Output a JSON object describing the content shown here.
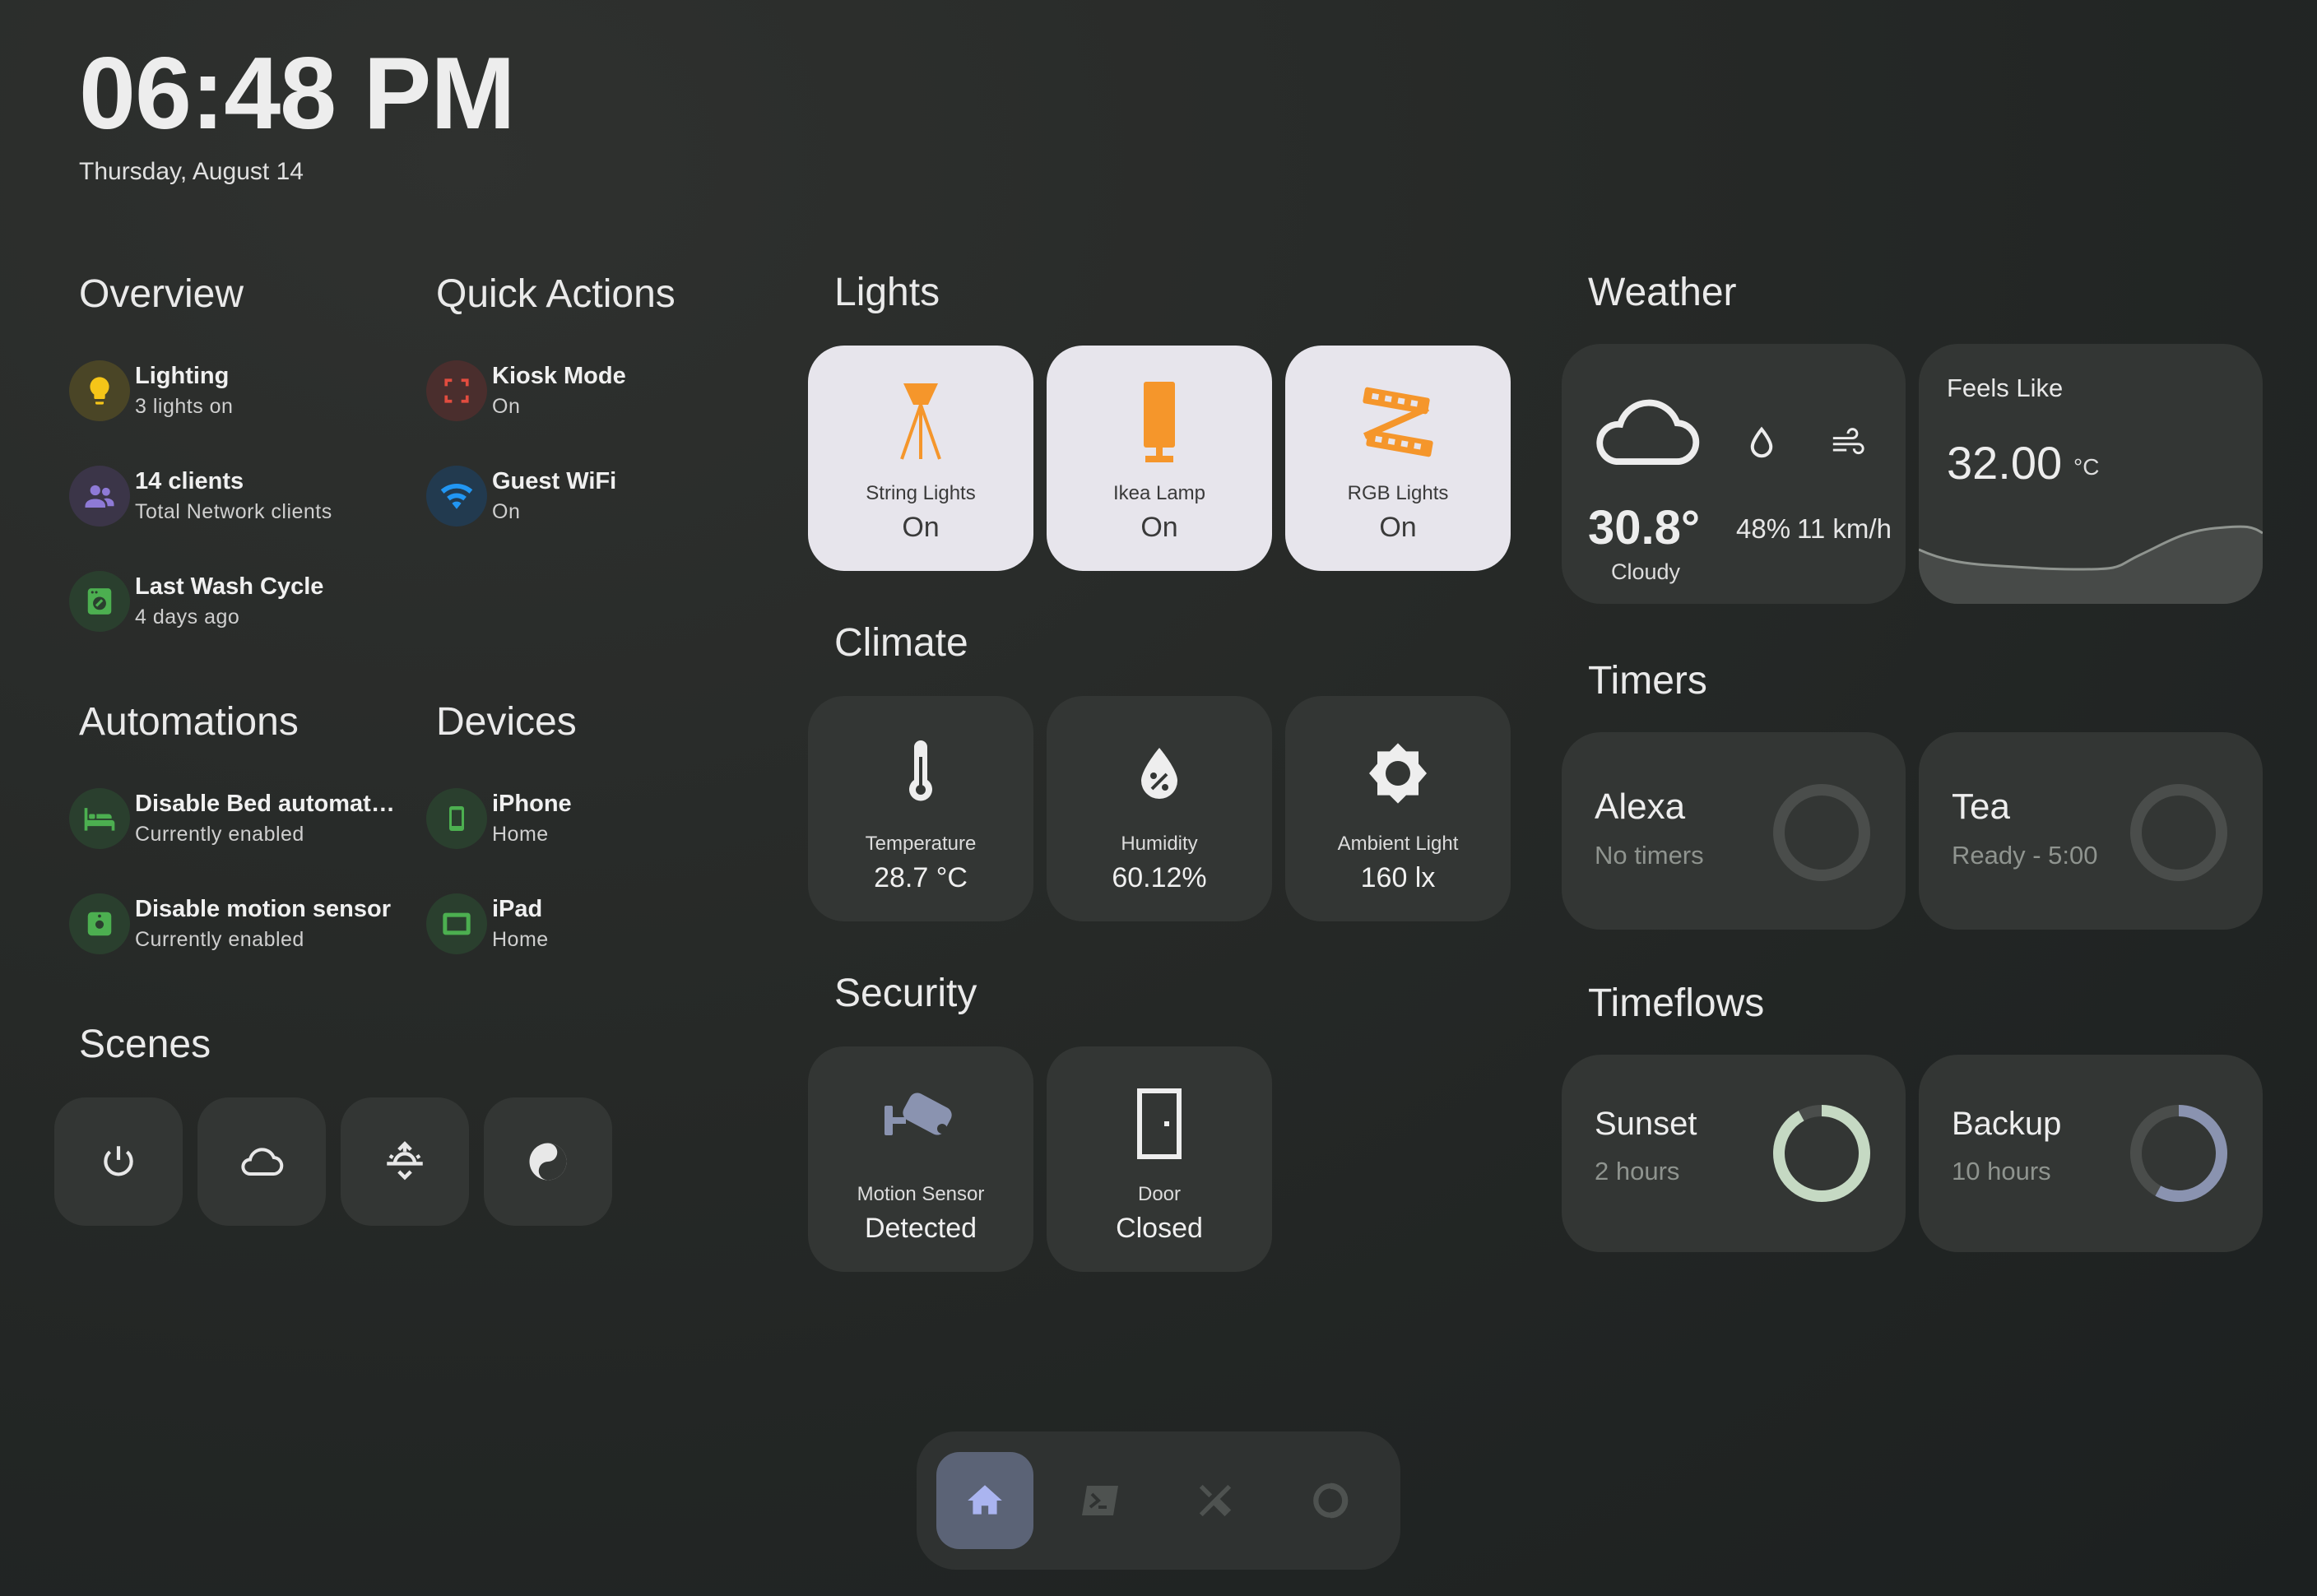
{
  "clock": {
    "time": "06:48 PM",
    "date": "Thursday, August 14"
  },
  "overview": {
    "title": "Overview",
    "items": [
      {
        "title": "Lighting",
        "sub": "3 lights on",
        "icon": "lightbulb-icon"
      },
      {
        "title": "14 clients",
        "sub": "Total Network clients",
        "icon": "people-icon"
      },
      {
        "title": "Last Wash Cycle",
        "sub": "4 days ago",
        "icon": "washing-machine-icon"
      }
    ]
  },
  "quick_actions": {
    "title": "Quick Actions",
    "items": [
      {
        "title": "Kiosk Mode",
        "sub": "On",
        "icon": "fullscreen-icon"
      },
      {
        "title": "Guest WiFi",
        "sub": "On",
        "icon": "wifi-icon"
      }
    ]
  },
  "automations": {
    "title": "Automations",
    "items": [
      {
        "title": "Disable Bed automat…",
        "sub": "Currently enabled",
        "icon": "bed-icon"
      },
      {
        "title": "Disable motion sensor",
        "sub": "Currently enabled",
        "icon": "motion-sensor-icon"
      }
    ]
  },
  "devices": {
    "title": "Devices",
    "items": [
      {
        "title": "iPhone",
        "sub": "Home",
        "icon": "phone-icon"
      },
      {
        "title": "iPad",
        "sub": "Home",
        "icon": "tablet-icon"
      }
    ]
  },
  "scenes": {
    "title": "Scenes",
    "buttons": [
      "power-icon",
      "cloud-icon",
      "sunset-icon",
      "yin-yang-icon"
    ]
  },
  "lights": {
    "title": "Lights",
    "tiles": [
      {
        "label": "String Lights",
        "value": "On",
        "icon": "string-lights-icon"
      },
      {
        "label": "Ikea Lamp",
        "value": "On",
        "icon": "lamp-icon"
      },
      {
        "label": "RGB Lights",
        "value": "On",
        "icon": "led-strip-icon"
      }
    ]
  },
  "climate": {
    "title": "Climate",
    "tiles": [
      {
        "label": "Temperature",
        "value": "28.7 °C",
        "icon": "thermometer-icon"
      },
      {
        "label": "Humidity",
        "value": "60.12%",
        "icon": "humidity-icon"
      },
      {
        "label": "Ambient Light",
        "value": "160 lx",
        "icon": "brightness-icon"
      }
    ]
  },
  "security": {
    "title": "Security",
    "tiles": [
      {
        "label": "Motion Sensor",
        "value": "Detected",
        "icon": "security-camera-icon"
      },
      {
        "label": "Door",
        "value": "Closed",
        "icon": "door-icon"
      }
    ]
  },
  "weather": {
    "title": "Weather",
    "temperature": "30.8°",
    "condition": "Cloudy",
    "humidity": "48%",
    "wind": "11 km/h",
    "feels_like_label": "Feels Like",
    "feels_like_value": "32.00",
    "feels_like_unit": "°C"
  },
  "timers": {
    "title": "Timers",
    "items": [
      {
        "name": "Alexa",
        "sub": "No timers"
      },
      {
        "name": "Tea",
        "sub": "Ready - 5:00"
      }
    ]
  },
  "timeflows": {
    "title": "Timeflows",
    "items": [
      {
        "name": "Sunset",
        "sub": "2 hours",
        "progress": 0.92,
        "color": "#c5d9c3"
      },
      {
        "name": "Backup",
        "sub": "10 hours",
        "progress": 0.58,
        "color": "#8a93b0"
      }
    ]
  },
  "nav": {
    "items": [
      "home-icon",
      "terminal-icon",
      "tools-icon",
      "circle-icon"
    ],
    "active": 0
  },
  "colors": {
    "accent_orange": "#f5962b",
    "green": "#4caf50",
    "blue": "#2196f3",
    "red": "#e24c3f",
    "purple": "#8e7ad6",
    "yellow": "#f5c518",
    "nav_active": "#5b6376"
  }
}
